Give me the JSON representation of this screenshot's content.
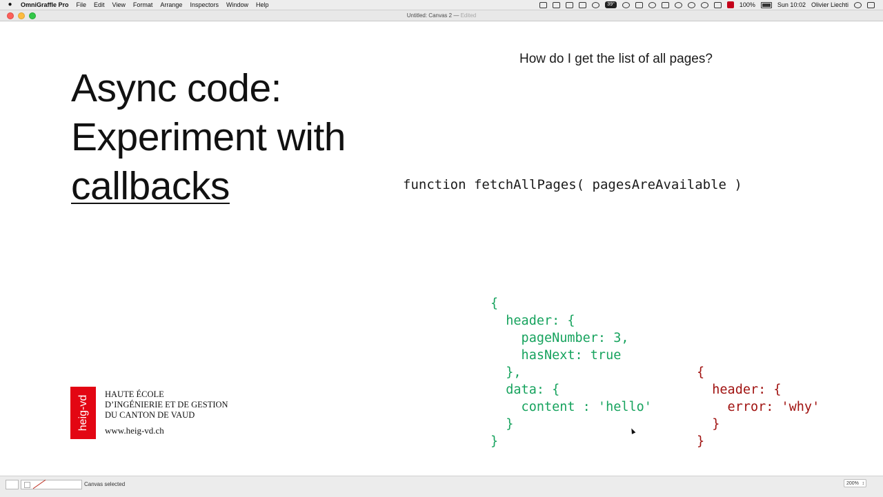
{
  "menubar": {
    "app": "OmniGraffle Pro",
    "menus": [
      "File",
      "Edit",
      "View",
      "Format",
      "Arrange",
      "Inspectors",
      "Window",
      "Help"
    ],
    "temperature": "39°",
    "battery": "100%",
    "clock": "Sun 10:02",
    "user": "Olivier Liechti"
  },
  "window": {
    "title": "Untitled: Canvas 2 —",
    "status": "Edited"
  },
  "slide": {
    "title_lines": [
      "Async code:",
      "Experiment with",
      "callbacks"
    ],
    "question": "How do I get the list of all pages?",
    "signature": "function fetchAllPages( pagesAreAvailable )",
    "success_json": "{\n  header: {\n    pageNumber: 3,\n    hasNext: true\n  },\n  data: {\n    content : 'hello'\n  }\n}",
    "error_json": "{\n  header: {\n    error: 'why'\n  }\n}",
    "colors": {
      "success": "#17a35e",
      "error": "#a01210"
    }
  },
  "logo": {
    "mark": "heig-vd",
    "lines": [
      "HAUTE ÉCOLE",
      "D’INGÉNIERIE ET DE GESTION",
      "DU CANTON DE VAUD"
    ],
    "url": "www.heig-vd.ch",
    "color": "#e30613"
  },
  "statusbar": {
    "status": "Canvas selected",
    "zoom": "200%"
  }
}
